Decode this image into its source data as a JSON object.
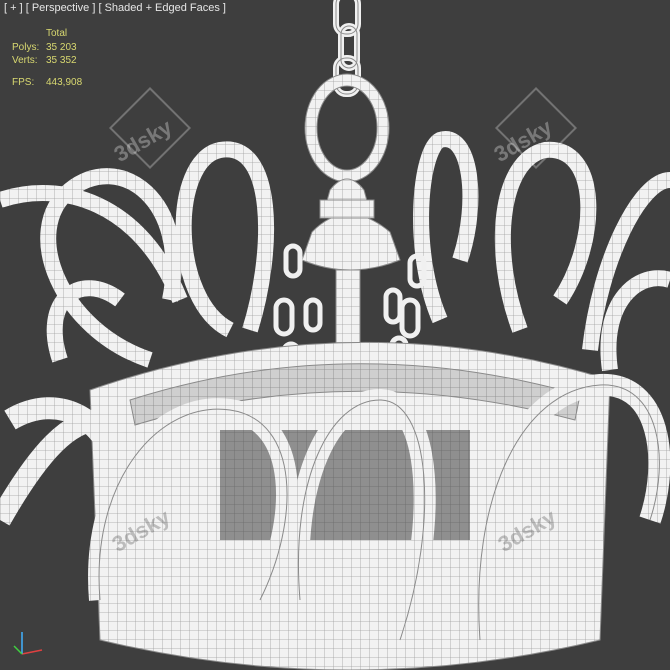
{
  "viewport": {
    "label_plus": "[ + ]",
    "label_view": "[ Perspective ]",
    "label_shading": "[ Shaded + Edged Faces ]"
  },
  "stats": {
    "header": "Total",
    "polys_label": "Polys:",
    "polys_value": "35 203",
    "verts_label": "Verts:",
    "verts_value": "35 352",
    "fps_label": "FPS:",
    "fps_value": "443,908"
  },
  "watermark": {
    "text": "3dsky"
  },
  "colors": {
    "background": "#3e3e3e",
    "mesh": "#f2f2f2",
    "edges": "#9a9a9a",
    "label_text": "#e6e6e6",
    "stats_text": "#d8d870"
  }
}
